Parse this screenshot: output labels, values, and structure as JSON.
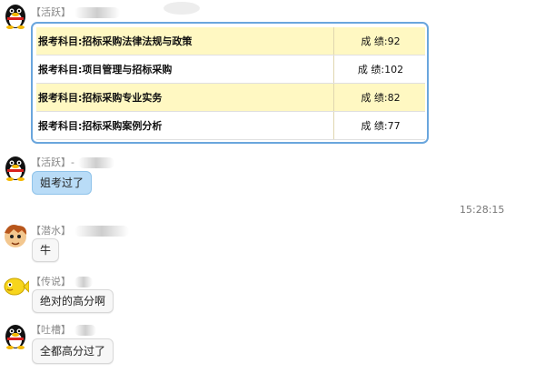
{
  "chat": {
    "messages": [
      {
        "sender_tag": "【活跃】",
        "avatar_icon": "qq-penguin-icon",
        "type": "table",
        "rows": [
          {
            "subject": "报考科目:招标采购法律法规与政策",
            "score": "成 绩:92"
          },
          {
            "subject": "报考科目:项目管理与招标采购",
            "score": "成 绩:102"
          },
          {
            "subject": "报考科目:招标采购专业实务",
            "score": "成 绩:82"
          },
          {
            "subject": "报考科目:招标采购案例分析",
            "score": "成 绩:77"
          }
        ]
      },
      {
        "sender_tag": "【活跃】",
        "sender_extra": "-",
        "avatar_icon": "qq-penguin-icon",
        "text": "姐考过了"
      },
      {
        "sender_tag": "【潜水】",
        "avatar_icon": "cartoon-face-icon",
        "text": "牛"
      },
      {
        "sender_tag": "【传说】",
        "avatar_icon": "yellow-fish-icon",
        "text": "绝对的高分啊"
      },
      {
        "sender_tag": "【吐槽】",
        "avatar_icon": "qq-penguin-icon",
        "text": "全都高分过了"
      }
    ],
    "timestamp": "15:28:15"
  },
  "colors": {
    "highlight_row": "#fff8c2",
    "table_border": "#6aa6dd",
    "blue_bubble": "#b9dcf7"
  }
}
